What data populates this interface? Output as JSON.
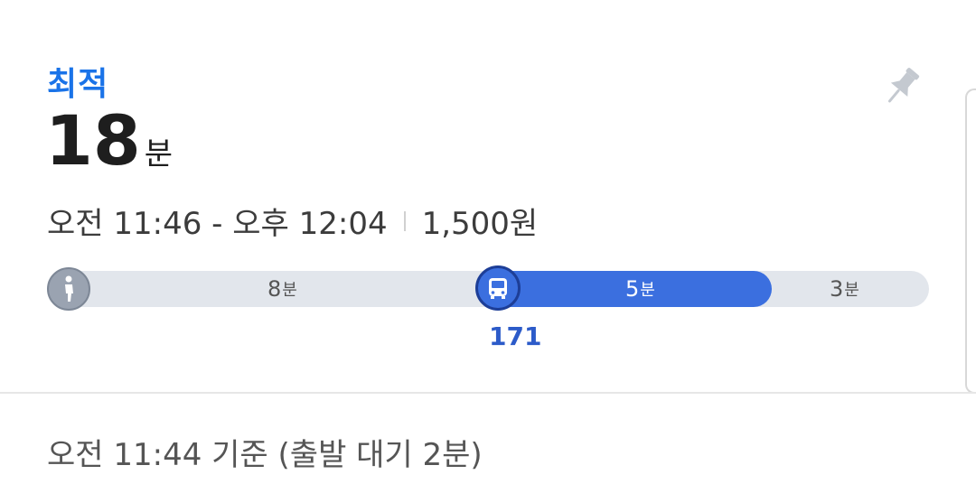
{
  "route": {
    "badge": "최적",
    "duration_value": "18",
    "duration_unit": "분",
    "time_range": "오전 11:46 - 오후 12:04",
    "fare": "1,500원",
    "pin_icon": "pin-icon"
  },
  "segments": {
    "walk": {
      "minutes": "8",
      "unit": "분",
      "icon": "walk-icon"
    },
    "bus": {
      "minutes": "5",
      "unit": "분",
      "icon": "bus-icon",
      "route_number": "171"
    },
    "final": {
      "minutes": "3",
      "unit": "분"
    }
  },
  "footer": {
    "base_time": "오전 11:44 기준 (출발 대기 2분)"
  },
  "colors": {
    "accent": "#1a73e8",
    "bus": "#3b6fdf",
    "track": "#e2e6ec",
    "walk": "#9aa3b1"
  }
}
